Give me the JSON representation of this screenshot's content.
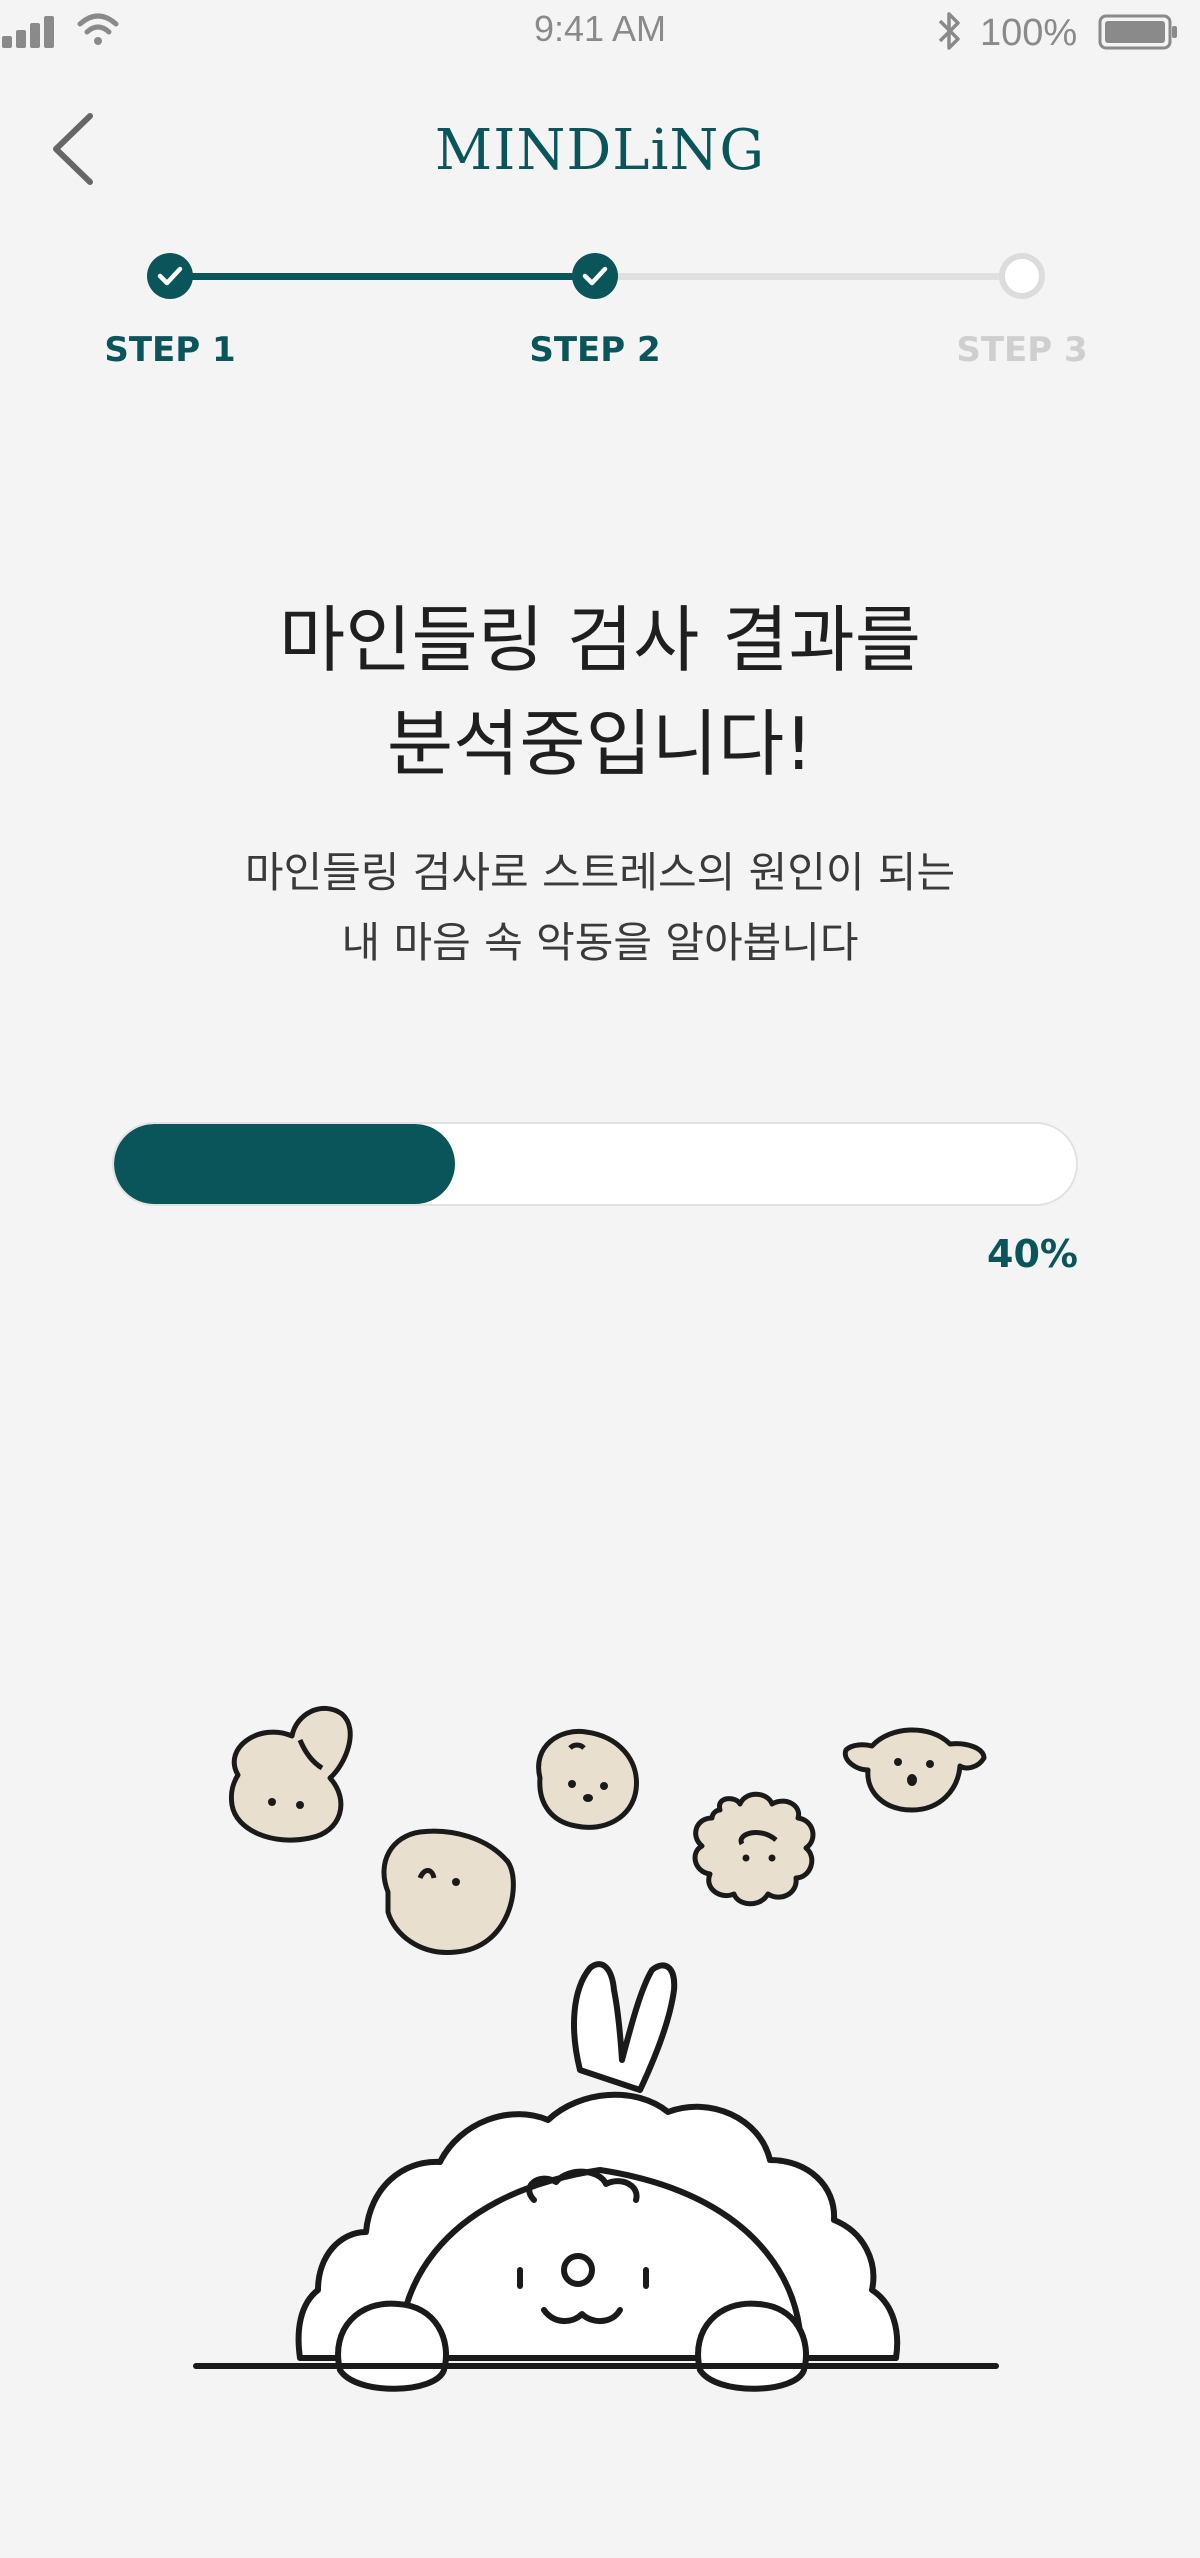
{
  "status_bar": {
    "time": "9:41 AM",
    "battery_percent": "100%",
    "icons": [
      "signal-icon",
      "wifi-icon",
      "bluetooth-icon",
      "battery-icon"
    ]
  },
  "header": {
    "back_icon": "chevron-left-icon",
    "brand": "MINDLiNG"
  },
  "stepper": {
    "steps": [
      {
        "label": "STEP 1",
        "state": "done"
      },
      {
        "label": "STEP 2",
        "state": "done"
      },
      {
        "label": "STEP 3",
        "state": "todo"
      }
    ]
  },
  "content": {
    "title_line1": "마인들링 검사 결과를",
    "title_line2": "분석중입니다!",
    "subtitle_line1": "마인들링 검사로 스트레스의 원인이 되는",
    "subtitle_line2": "내 마음 속 악동을 알아봅니다"
  },
  "progress": {
    "value": 40,
    "label": "40%"
  },
  "colors": {
    "accent": "#0a5559",
    "background": "#f4f4f4",
    "inactive": "#dcdcdc",
    "character_fill": "#e8dfcf"
  }
}
